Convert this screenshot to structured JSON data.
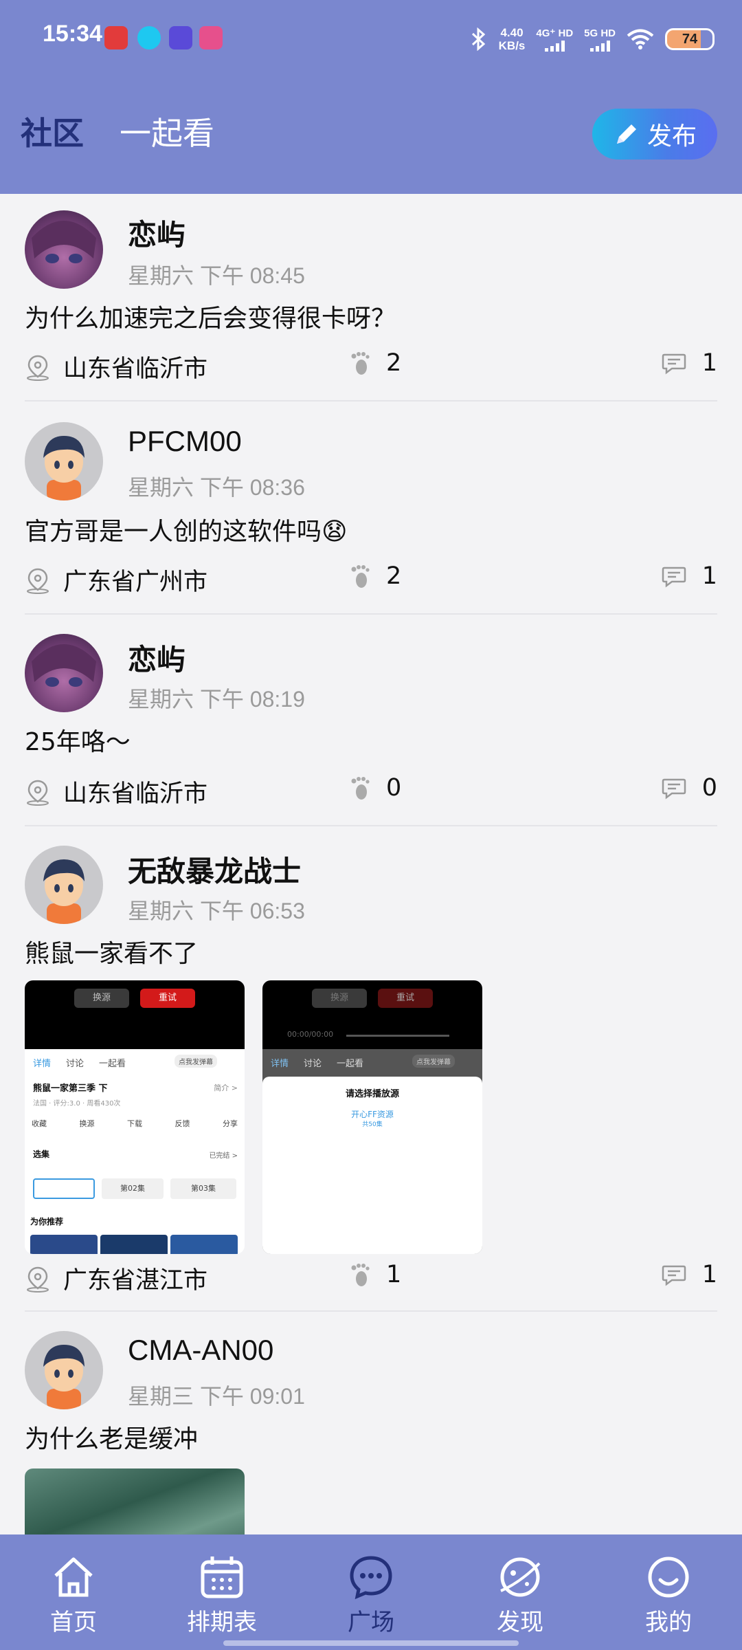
{
  "status_bar": {
    "time": "15:34",
    "net_speed_value": "4.40",
    "net_speed_unit": "KB/s",
    "sim1": "4G⁺ HD",
    "sim2": "5G HD",
    "battery": "74",
    "icons": [
      "netease-music-icon",
      "qq-icon",
      "browser-icon",
      "app-icon",
      "bluetooth-icon",
      "wifi-icon"
    ]
  },
  "header": {
    "tabs": [
      {
        "label": "社区",
        "active": true
      },
      {
        "label": "一起看",
        "active": false
      }
    ],
    "publish_label": "发布",
    "publish_icon": "pencil-icon"
  },
  "posts": [
    {
      "username": "恋屿",
      "date": "星期六 下午 08:45",
      "text": "为什么加速完之后会变得很卡呀？",
      "location": "山东省临沂市",
      "footprints": "2",
      "comments": "1"
    },
    {
      "username": "PFCM00",
      "date": "星期六 下午 08:36",
      "text": "官方哥是一人创的这软件吗😧",
      "location": "广东省广州市",
      "footprints": "2",
      "comments": "1"
    },
    {
      "username": "恋屿",
      "date": "星期六 下午 08:19",
      "text": "25年咯～",
      "location": "山东省临沂市",
      "footprints": "0",
      "comments": "0"
    },
    {
      "username": "无敌暴龙战士",
      "date": "星期六 下午 06:53",
      "text": "熊鼠一家看不了",
      "location": "广东省湛江市",
      "footprints": "1",
      "comments": "1",
      "shot1": {
        "btn_switch": "换源",
        "btn_retry": "重试",
        "tabs": [
          "详情",
          "讨论",
          "一起看"
        ],
        "danmaku": "点我发弹幕",
        "title": "熊鼠一家第三季 下",
        "intro": "简介 >",
        "meta": "法国 · 评分:3.0 · 周看430次",
        "actions": [
          "收藏",
          "换源",
          "下载",
          "反馈",
          "分享"
        ],
        "episodes_label": "选集",
        "episodes_status": "已完结 >",
        "episodes": [
          "",
          "第02集",
          "第03集"
        ],
        "recommend": "为你推荐"
      },
      "shot2": {
        "btn_switch": "换源",
        "btn_retry": "重试",
        "player_time": "00:00/00:00",
        "tabs": [
          "详情",
          "讨论",
          "一起看"
        ],
        "danmaku": "点我发弹幕",
        "dialog_title": "请选择播放源",
        "source_name": "开心FF资源",
        "source_count": "共50集"
      }
    },
    {
      "username": "CMA-AN00",
      "date": "星期三 下午 09:01",
      "text": "为什么老是缓冲"
    }
  ],
  "bottom_nav": [
    {
      "label": "首页",
      "icon": "home-icon",
      "active": false
    },
    {
      "label": "排期表",
      "icon": "calendar-icon",
      "active": false
    },
    {
      "label": "广场",
      "icon": "chat-bubble-icon",
      "active": true
    },
    {
      "label": "发现",
      "icon": "planet-icon",
      "active": false
    },
    {
      "label": "我的",
      "icon": "smile-icon",
      "active": false
    }
  ],
  "colors": {
    "header_bg": "#7a87cf",
    "active_tab": "#23307a",
    "publish_gradient_start": "#1fb6e8",
    "publish_gradient_end": "#5a6ef0",
    "feed_bg": "#f3f3f5"
  }
}
